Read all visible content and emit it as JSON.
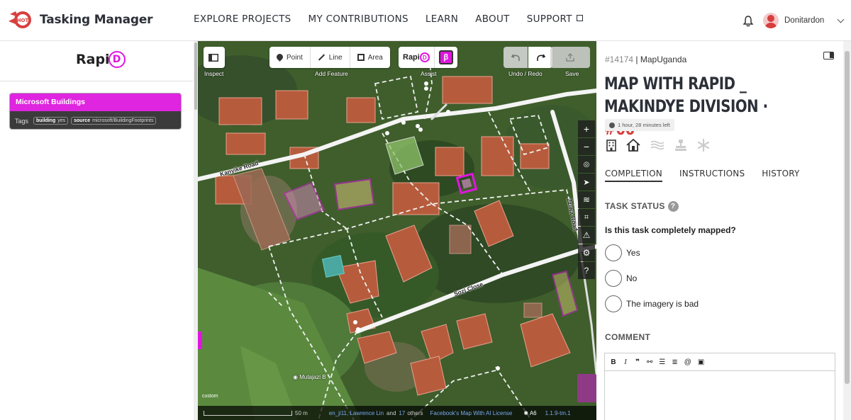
{
  "app": {
    "logo_badge": "HOT",
    "title": "Tasking Manager"
  },
  "nav": {
    "items": [
      "EXPLORE PROJECTS",
      "MY CONTRIBUTIONS",
      "LEARN",
      "ABOUT",
      "SUPPORT"
    ]
  },
  "user": {
    "name": "Donitardon"
  },
  "left_panel": {
    "rapid_logo_prefix": "Rapi",
    "rapid_logo_suffix": "D",
    "dataset_title": "Microsoft Buildings",
    "tags_label": "Tags",
    "tags": [
      {
        "key": "building",
        "value": "yes"
      },
      {
        "key": "source",
        "value": "microsoft/BuildingFootprints"
      }
    ]
  },
  "map": {
    "toolbar": {
      "inspect_caption": "Inspect",
      "point_label": "Point",
      "line_label": "Line",
      "area_label": "Area",
      "add_feature_caption": "Add Feature",
      "assist_caption": "Assist",
      "rapid_prefix": "Rapi",
      "rapid_suffix": "D",
      "beta_symbol": "β",
      "undo_redo_caption": "Undo / Redo",
      "save_caption": "Save"
    },
    "road_labels": {
      "kanyike": "Kanyike Road",
      "sozi": "Sozi Close",
      "zziwa": "Zziwa Road"
    },
    "poi_label": "Mutajazi B",
    "imagery_label": "custom",
    "footer": {
      "scale": "50 m",
      "contributors": "en_ji11, Lawrence Lin",
      "and_text": "and",
      "others_count": "17",
      "others_text": "others",
      "license": "Facebook's Map With AI License",
      "issues_text": "A6",
      "version": "1.1.9-tm.1"
    }
  },
  "task": {
    "project_id": "#14174",
    "separator": "|",
    "organisation": "MapUganda",
    "title": "MAP WITH RAPID _ MAKINDYE DIVISION ·",
    "task_number": "#66",
    "time_left": "1 hour, 28 minutes left",
    "tabs": [
      "COMPLETION",
      "INSTRUCTIONS",
      "HISTORY"
    ],
    "status_heading": "TASK STATUS",
    "help_glyph": "?",
    "question": "Is this task completely mapped?",
    "options": [
      "Yes",
      "No",
      "The imagery is bad"
    ],
    "comment_heading": "COMMENT"
  },
  "colors": {
    "brand_red": "#d73f3f",
    "rapid_magenta": "#e015e0",
    "text_dark": "#2c3038"
  }
}
